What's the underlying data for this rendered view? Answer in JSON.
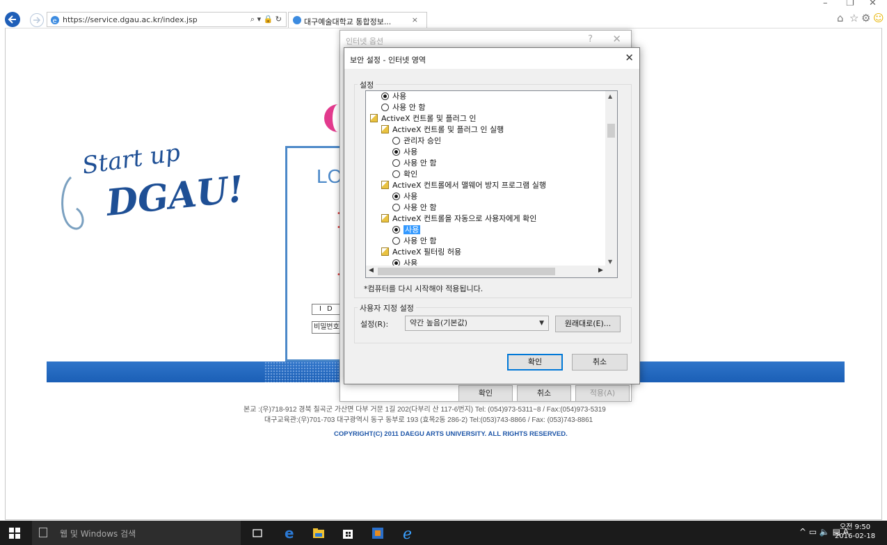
{
  "browser": {
    "url": "https://service.dgau.ac.kr/index.jsp",
    "addr_controls": "⌕ ▾ 🔒 ↻",
    "tab_title": "대구예술대학교 통합정보...",
    "tab_close": "×",
    "win_min": "–",
    "win_restore": "❐",
    "win_close": "✕"
  },
  "page": {
    "slogan_line1": "Start up",
    "slogan_line2": "DGAU!",
    "login_title": "LO",
    "id_label": "ID",
    "pw_label": "비밀번호",
    "footer_line1": "본교 :(우)718-912 경북 칠곡군 가산면 다부 거문 1길 202(다부리 산 117-6번지) Tel: (054)973-5311~8 / Fax:(054)973-5319",
    "footer_line2": "대구교육관:(우)701-703 대구광역시 동구 동부로 193 (효목2동 286-2) Tel:(053)743-8866 / Fax: (053)743-8861",
    "copyright": "COPYRIGHT(C) 2011 DAEGU ARTS UNIVERSITY. ALL RIGHTS RESERVED."
  },
  "bg_dialog": {
    "title": "인터넷 옵션",
    "help": "?",
    "close": "✕",
    "ok": "확인",
    "cancel": "취소",
    "apply": "적용(A)"
  },
  "dialog": {
    "title": "보안 설정 - 인터넷 영역",
    "close": "✕",
    "settings_group": "설정",
    "settings": [
      {
        "kind": "radio",
        "label": "사용",
        "checked": true,
        "indent": 1
      },
      {
        "kind": "radio",
        "label": "사용 안 함",
        "checked": false,
        "indent": 1
      },
      {
        "kind": "folder",
        "label": "ActiveX 컨트롤 및 플러그 인",
        "indent": 0
      },
      {
        "kind": "folder",
        "label": "ActiveX 컨트롤 및 플러그 인 실행",
        "indent": 1
      },
      {
        "kind": "radio",
        "label": "관리자 승인",
        "checked": false,
        "indent": 2
      },
      {
        "kind": "radio",
        "label": "사용",
        "checked": true,
        "indent": 2
      },
      {
        "kind": "radio",
        "label": "사용 안 함",
        "checked": false,
        "indent": 2
      },
      {
        "kind": "radio",
        "label": "확인",
        "checked": false,
        "indent": 2
      },
      {
        "kind": "folder",
        "label": "ActiveX 컨트롤에서 맬웨어 방지 프로그램 실행",
        "indent": 1
      },
      {
        "kind": "radio",
        "label": "사용",
        "checked": true,
        "indent": 2
      },
      {
        "kind": "radio",
        "label": "사용 안 함",
        "checked": false,
        "indent": 2
      },
      {
        "kind": "folder",
        "label": "ActiveX 컨트롤을 자동으로 사용자에게 확인",
        "indent": 1
      },
      {
        "kind": "radio",
        "label": "사용",
        "checked": true,
        "indent": 2,
        "selected": true
      },
      {
        "kind": "radio",
        "label": "사용 안 함",
        "checked": false,
        "indent": 2
      },
      {
        "kind": "folder",
        "label": "ActiveX 필터링 허용",
        "indent": 1
      },
      {
        "kind": "radio",
        "label": "사용",
        "checked": true,
        "indent": 2
      }
    ],
    "restart_note": "*컴퓨터를 다시 시작해야 적용됩니다.",
    "custom_group": "사용자 지정 설정",
    "reset_label": "설정(R):",
    "reset_value": "약간 높음(기본값)",
    "reset_button": "원래대로(E)...",
    "ok": "확인",
    "cancel": "취소"
  },
  "taskbar": {
    "search_placeholder": "웹 및 Windows 검색",
    "tray_text": "^ ▭ 🔈 ▤ A",
    "time": "오전 9:50",
    "date": "2016-02-18"
  },
  "colors": {
    "accent": "#0078d7",
    "bluebar": "#2f74c9",
    "slogan": "#1e4f95",
    "pink": "#e23a8d"
  }
}
